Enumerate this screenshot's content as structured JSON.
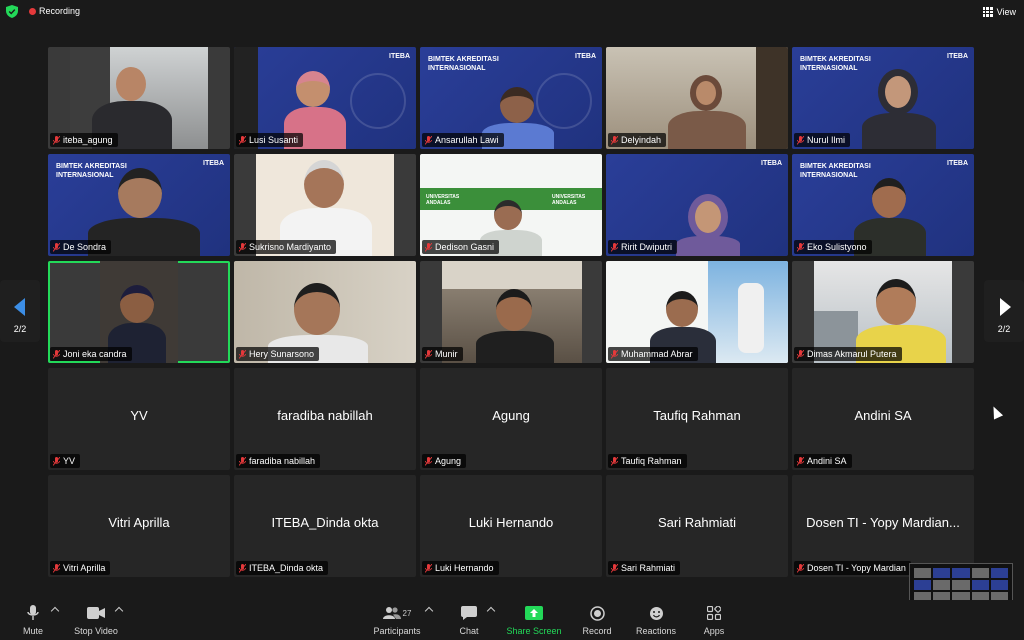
{
  "top": {
    "recording_label": "Recording",
    "view_label": "View"
  },
  "nav": {
    "left_page": "2/2",
    "right_page": "2/2"
  },
  "slides": {
    "title_line1": "BIMTEK AKREDITASI",
    "title_line2": "INTERNASIONAL",
    "logo": "ITEBA",
    "unand_logo": "UNIVERSITAS ANDALAS"
  },
  "tiles": [
    {
      "name": "iteba_agung",
      "kind": "video"
    },
    {
      "name": "Lusi Susanti",
      "kind": "slide"
    },
    {
      "name": "Ansarullah Lawi",
      "kind": "slide"
    },
    {
      "name": "Delyindah",
      "kind": "video"
    },
    {
      "name": "Nurul Ilmi",
      "kind": "slide"
    },
    {
      "name": "De Sondra",
      "kind": "slide"
    },
    {
      "name": "Sukrisno Mardiyanto",
      "kind": "video"
    },
    {
      "name": "Dedison Gasni",
      "kind": "white"
    },
    {
      "name": "Ririt Dwiputri",
      "kind": "slide"
    },
    {
      "name": "Eko Sulistyono",
      "kind": "slide"
    },
    {
      "name": "Joni eka candra",
      "kind": "video",
      "active": true
    },
    {
      "name": "Hery Sunarsono",
      "kind": "video"
    },
    {
      "name": "Munir",
      "kind": "video"
    },
    {
      "name": "Muhammad Abrar",
      "kind": "white"
    },
    {
      "name": "Dimas Akmarul Putera",
      "kind": "video"
    },
    {
      "name": "YV",
      "center": "YV"
    },
    {
      "name": "faradiba nabillah",
      "center": "faradiba nabillah"
    },
    {
      "name": "Agung",
      "center": "Agung"
    },
    {
      "name": "Taufiq Rahman",
      "center": "Taufiq Rahman"
    },
    {
      "name": "Andini SA",
      "center": "Andini SA"
    },
    {
      "name": "Vitri Aprilla",
      "center": "Vitri Aprilla"
    },
    {
      "name": "ITEBA_Dinda okta",
      "center": "ITEBA_Dinda okta"
    },
    {
      "name": "Luki Hernando",
      "center": "Luki Hernando"
    },
    {
      "name": "Sari Rahmiati",
      "center": "Sari Rahmiati"
    },
    {
      "name": "Dosen TI - Yopy Mardian",
      "center": "Dosen TI - Yopy Mardian..."
    }
  ],
  "toolbar": {
    "mute": "Mute",
    "stop_video": "Stop Video",
    "participants": "Participants",
    "participants_count": "27",
    "chat": "Chat",
    "share_screen": "Share Screen",
    "record": "Record",
    "reactions": "Reactions",
    "apps": "Apps"
  },
  "colors": {
    "accent_green": "#23d959",
    "recording_red": "#e5393b",
    "slide_blue": "#2a3e98",
    "nav_blue": "#3c8ee6"
  }
}
